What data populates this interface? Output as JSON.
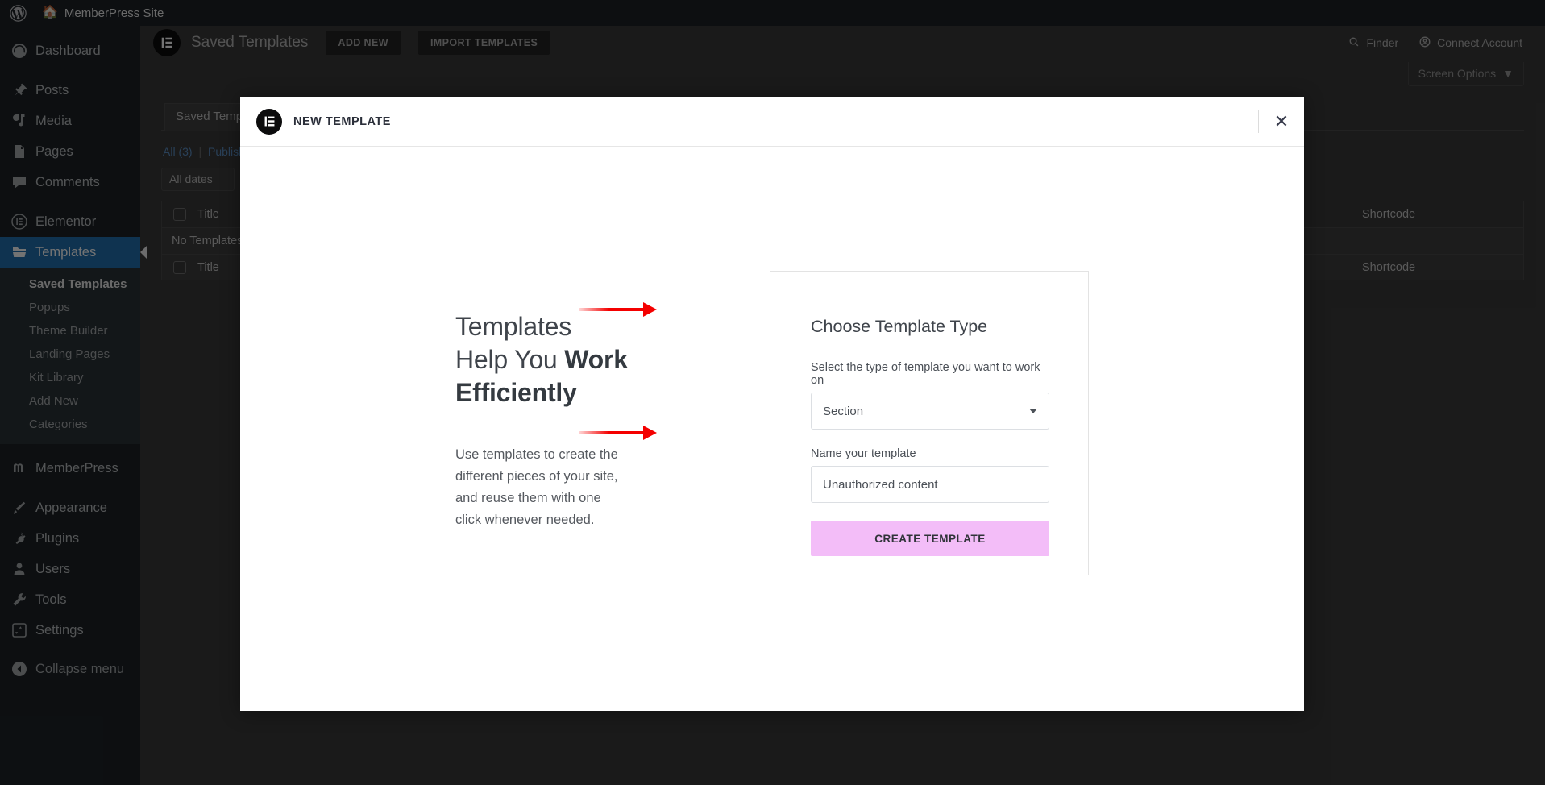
{
  "adminbar": {
    "wp_logo_icon": "wordpress-logo-icon",
    "home_icon": "home-icon",
    "site_name": "MemberPress Site"
  },
  "sidebar": {
    "items": [
      {
        "label": "Dashboard",
        "icon": "dashboard-icon",
        "current": false
      },
      {
        "label": "Posts",
        "icon": "pin-icon",
        "current": false
      },
      {
        "label": "Media",
        "icon": "media-icon",
        "current": false
      },
      {
        "label": "Pages",
        "icon": "pages-icon",
        "current": false
      },
      {
        "label": "Comments",
        "icon": "comments-icon",
        "current": false
      },
      {
        "label": "Elementor",
        "icon": "elementor-icon",
        "current": false
      },
      {
        "label": "Templates",
        "icon": "folder-icon",
        "current": true
      },
      {
        "label": "MemberPress",
        "icon": "memberpress-icon",
        "current": false
      },
      {
        "label": "Appearance",
        "icon": "brush-icon",
        "current": false
      },
      {
        "label": "Plugins",
        "icon": "plug-icon",
        "current": false
      },
      {
        "label": "Users",
        "icon": "users-icon",
        "current": false
      },
      {
        "label": "Tools",
        "icon": "wrench-icon",
        "current": false
      },
      {
        "label": "Settings",
        "icon": "settings-icon",
        "current": false
      }
    ],
    "submenu": [
      {
        "label": "Saved Templates",
        "active": true
      },
      {
        "label": "Popups",
        "active": false
      },
      {
        "label": "Theme Builder",
        "active": false
      },
      {
        "label": "Landing Pages",
        "active": false
      },
      {
        "label": "Kit Library",
        "active": false
      },
      {
        "label": "Add New",
        "active": false
      },
      {
        "label": "Categories",
        "active": false
      }
    ],
    "collapse": {
      "label": "Collapse menu",
      "icon": "collapse-icon"
    }
  },
  "elementor_header": {
    "logo_icon": "elementor-logo-icon",
    "title": "Saved Templates",
    "add_new_label": "ADD NEW",
    "import_label": "IMPORT TEMPLATES",
    "finder_label": "Finder",
    "finder_icon": "search-icon",
    "connect_label": "Connect Account",
    "connect_icon": "account-circle-icon"
  },
  "page": {
    "screen_options_label": "Screen Options",
    "screen_options_icon": "chevron-down-icon",
    "tab_label": "Saved Templates",
    "filters": {
      "all": "All (3)",
      "separator": "|",
      "published": "Published"
    },
    "date_filter": "All dates",
    "table": {
      "columns": {
        "title": "Title",
        "shortcode": "Shortcode"
      },
      "empty_message": "No Templates",
      "rows": [
        {
          "type": "header",
          "title": "Title",
          "shortcode": "Shortcode"
        },
        {
          "type": "empty",
          "title": "No Templates",
          "shortcode": ""
        },
        {
          "type": "footer",
          "title": "Title",
          "shortcode": "Shortcode"
        }
      ]
    }
  },
  "modal": {
    "logo_icon": "elementor-logo-icon",
    "title": "NEW TEMPLATE",
    "close_icon": "close-icon",
    "promo": {
      "heading_line1": "Templates",
      "heading_line2_plain": "Help You ",
      "heading_line2_bold": "Work",
      "heading_line3_bold": "Efficiently",
      "body": "Use templates to create the different pieces of your site, and reuse them with one click whenever needed."
    },
    "form": {
      "heading": "Choose Template Type",
      "type_label": "Select the type of template you want to work on",
      "type_value": "Section",
      "type_caret_icon": "caret-down-icon",
      "name_label": "Name your template",
      "name_value": "Unauthorized content",
      "submit_label": "CREATE TEMPLATE"
    }
  },
  "annotations": [
    {
      "name": "arrow-to-template-type-select",
      "color": "#f40000"
    },
    {
      "name": "arrow-to-create-template-button",
      "color": "#f40000"
    }
  ],
  "colors": {
    "accent_button": "#f3bdf8",
    "arrow": "#f40000",
    "wp_blue": "#2271b1",
    "admin_dark": "#1d2327"
  }
}
